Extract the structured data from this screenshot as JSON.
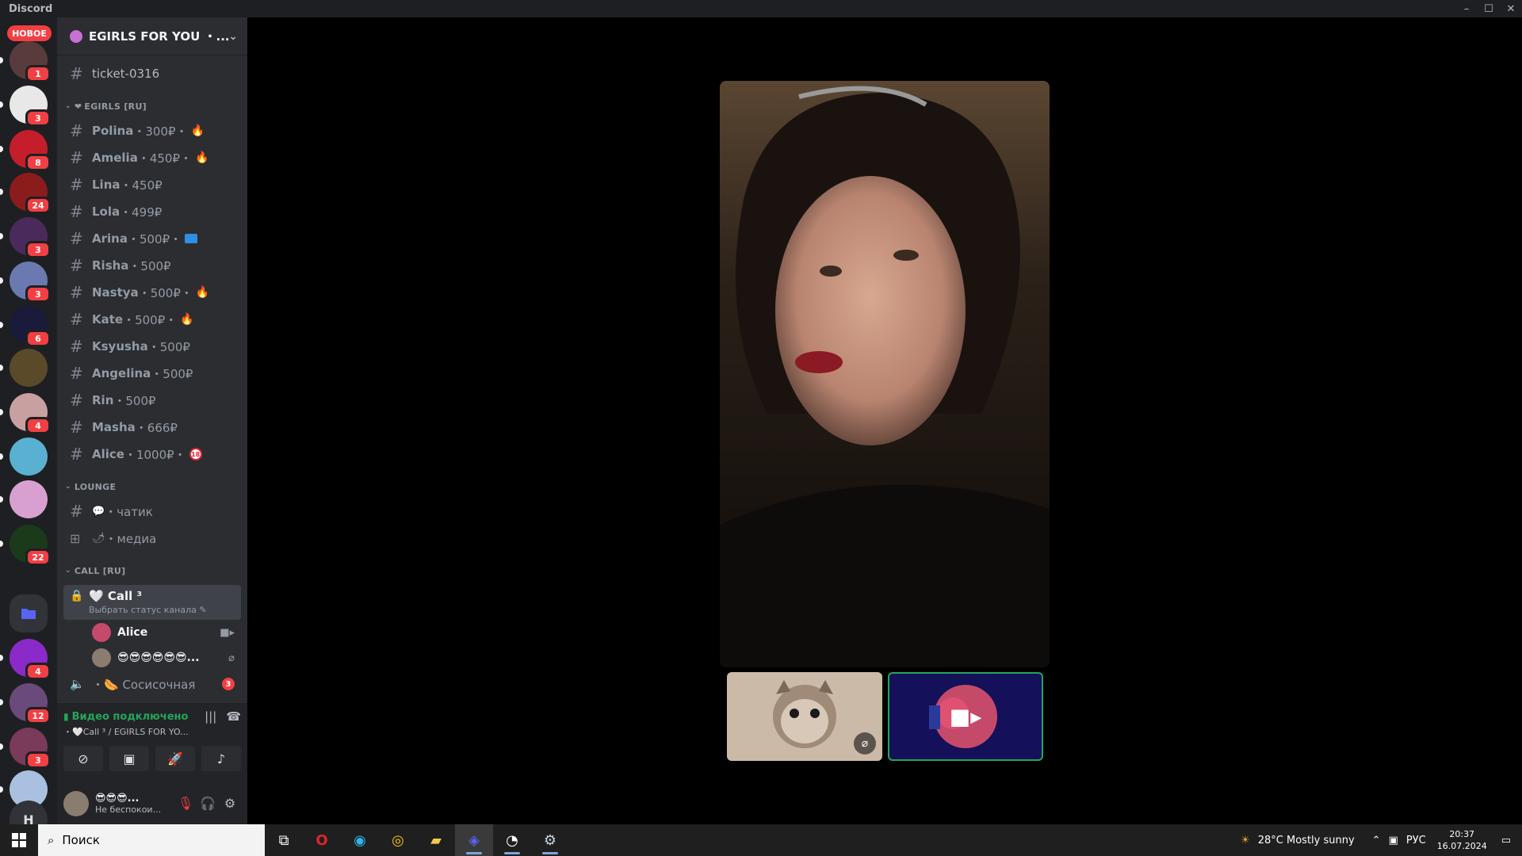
{
  "window": {
    "title": "Discord",
    "minimize": "–",
    "maximize": "☐",
    "close": "✕"
  },
  "rail": {
    "new_label": "НОВОЕ",
    "bottom_letter": "H",
    "servers": [
      {
        "badge": "1",
        "color": "#5a3b3b"
      },
      {
        "badge": "3",
        "color": "#e8e8e8"
      },
      {
        "badge": "8",
        "color": "#c41e2a"
      },
      {
        "badge": "24",
        "color": "#8b1c1c"
      },
      {
        "badge": "3",
        "color": "#4a2a5a"
      },
      {
        "badge": "3",
        "color": "#6a7ab0"
      },
      {
        "badge": "6",
        "color": "#1a1a3a"
      },
      {
        "badge": "",
        "color": "#5a4a2a"
      },
      {
        "badge": "4",
        "color": "#c8a0a0"
      },
      {
        "badge": "",
        "color": "#5ab0d0"
      },
      {
        "badge": "",
        "color": "#d8a0d0"
      },
      {
        "badge": "22",
        "color": "#1a3a1a"
      },
      {
        "badge": "4",
        "color": "#8a2ac8"
      },
      {
        "badge": "12",
        "color": "#6a4a7a"
      },
      {
        "badge": "3",
        "color": "#7a3a5a"
      },
      {
        "badge": "",
        "color": "#aac0e0"
      }
    ]
  },
  "guild": {
    "name": "EGIRLS FOR YOU ・...",
    "top_channel": "ticket-0316",
    "categories": [
      {
        "name": "EGIRLS [RU]",
        "channels": [
          {
            "name": "Polina",
            "price": "・300₽・",
            "extra": "🔥"
          },
          {
            "name": "Amelia",
            "price": "・450₽・",
            "extra": "🔥"
          },
          {
            "name": "Lina",
            "price": "・450₽",
            "extra": ""
          },
          {
            "name": "Lola",
            "price": "・499₽",
            "extra": ""
          },
          {
            "name": "Arina",
            "price": "・500₽・",
            "extra": "blue"
          },
          {
            "name": "Risha",
            "price": "・500₽",
            "extra": ""
          },
          {
            "name": "Nastya",
            "price": "・500₽・",
            "extra": "🔥"
          },
          {
            "name": "Kate",
            "price": "・500₽・",
            "extra": "🔥"
          },
          {
            "name": "Ksyusha",
            "price": "・500₽",
            "extra": ""
          },
          {
            "name": "Angelina",
            "price": "・500₽",
            "extra": ""
          },
          {
            "name": "Rin",
            "price": "・500₽",
            "extra": ""
          },
          {
            "name": "Masha",
            "price": "・666₽",
            "extra": ""
          },
          {
            "name": "Alice",
            "price": "・1000₽・",
            "extra": "18"
          }
        ]
      },
      {
        "name": "LOUNGE",
        "channels": [
          {
            "icon": "💬",
            "name": "・чатик"
          },
          {
            "icon": "🌶",
            "name": "・медиа"
          }
        ]
      },
      {
        "name": "CALL [RU]",
        "voice": {
          "name": "🤍 Call ³",
          "status": "Выбрать статус канала ✎",
          "users": [
            {
              "name": "Alice",
              "icon": "■▸",
              "avatar": "#c54a6a"
            },
            {
              "name": "😎😎😎😎😎😎...",
              "icon": "⌀",
              "avatar": "#8a7d70"
            }
          ]
        },
        "other_voice": {
          "name": "・🌭 Сосисочная",
          "badge": "3"
        }
      }
    ]
  },
  "voice_panel": {
    "title": "Видео подключено",
    "subtitle": "・🤍Call ³ / EGIRLS FOR YO...",
    "buttons": [
      "camera-off",
      "screen-share",
      "activity",
      "soundboard"
    ]
  },
  "user_panel": {
    "name": "😎😎😎...",
    "status": "Не беспокои..."
  },
  "taskbar": {
    "search_placeholder": "Поиск",
    "weather": "28°C  Mostly sunny",
    "lang": "РУС",
    "time": "20:37",
    "date": "16.07.2024"
  },
  "colors": {
    "accent_green": "#23a55a",
    "badge_red": "#f23f43",
    "sidebar": "#2b2d31",
    "rail": "#1e1f22"
  }
}
